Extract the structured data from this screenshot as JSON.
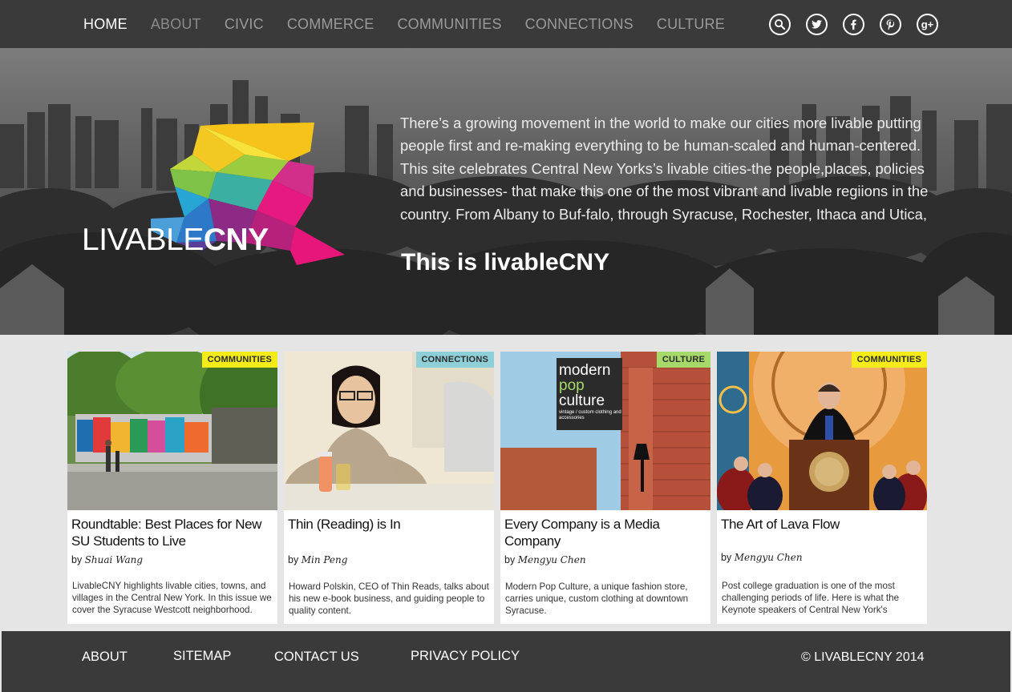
{
  "nav": {
    "items": [
      {
        "label": "HOME"
      },
      {
        "label": "ABOUT"
      },
      {
        "label": "CIVIC"
      },
      {
        "label": "COMMERCE"
      },
      {
        "label": "COMMUNITIES"
      },
      {
        "label": "CONNECTIONS"
      },
      {
        "label": "CULTURE"
      }
    ],
    "social": [
      {
        "icon": "search-icon"
      },
      {
        "icon": "twitter-icon"
      },
      {
        "icon": "facebook-icon"
      },
      {
        "icon": "pinterest-icon"
      },
      {
        "icon": "google-plus-icon",
        "glyph": "g+"
      }
    ]
  },
  "hero": {
    "logo_thin": "LIVABLE",
    "logo_bold": "CNY",
    "paragraph": "There’s a growing movement in the world to make our cities more livable putting people first and re-making everything to be human-scaled and human-centered. This site celebrates Central New Yorks’s livable cities-the people,places, policies and businesses- that make this one of the most vibrant and livable regiions in the country. From Albany to Buf-falo, through Syracuse, Rochester, Ithaca and Utica,",
    "tagline": "This is livableCNY"
  },
  "cards": [
    {
      "badge": "COMMUNITIES",
      "badge_color": "#f4ec1a",
      "title": "Roundtable: Best Places for New SU Students to Live",
      "by": "by",
      "author": "Shuai Wang",
      "description": "LivableCNY highlights livable cities, towns, and villages in the Central New York. In this issue we cover the Syracuse Westcott neighborhood."
    },
    {
      "badge": "CONNECTIONS",
      "badge_color": "#8fd0d8",
      "title": "Thin (Reading) is In",
      "by": "by",
      "author": "Min Peng",
      "description": "Howard Polskin, CEO of Thin Reads, talks about his new e-book business, and guiding people to quality content."
    },
    {
      "badge": "CULTURE",
      "badge_color": "#a6d86a",
      "title": "Every Company is a Media Company",
      "by": "by",
      "author": "Mengyu Chen",
      "description": "Modern Pop Culture, a unique fashion store, carries unique, custom clothing at downtown Syracuse."
    },
    {
      "badge": "COMMUNITIES",
      "badge_color": "#f4ec1a",
      "title": "The Art of Lava Flow",
      "by": "by",
      "author": "Mengyu Chen",
      "description": "Post college graduation is one of the most challenging periods of life. Here is what the Keynote speakers of Central New York's"
    }
  ],
  "card_images": {
    "sign_line1": "modern",
    "sign_line2": "pop",
    "sign_line3": "culture",
    "sign_sub": "vintage / custom clothing and accessories"
  },
  "footer": {
    "links": [
      "ABOUT",
      "SITEMAP",
      "CONTACT US",
      "PRIVACY POLICY"
    ],
    "copyright": "© LIVABLECNY 2014"
  }
}
